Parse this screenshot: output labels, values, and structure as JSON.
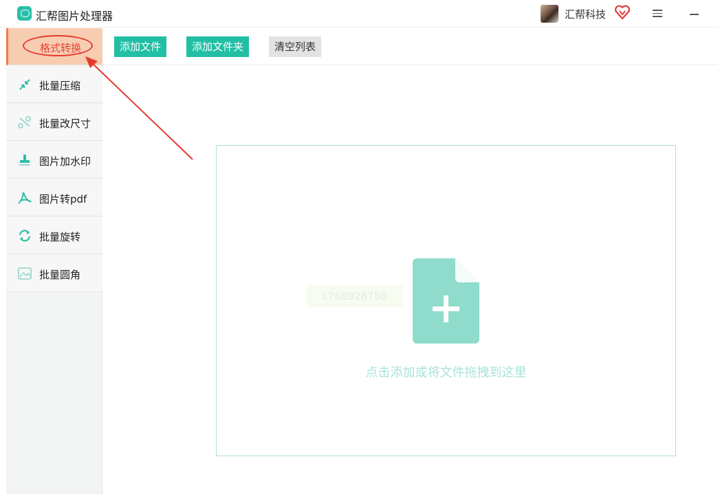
{
  "app": {
    "title": "汇帮图片处理器",
    "company": "汇帮科技",
    "icons": {
      "logo": "app-logo-icon",
      "vip": "vip-heart-icon",
      "menu": "hamburger-menu-icon",
      "minimize": "minimize-icon"
    }
  },
  "sidebar": {
    "items": [
      {
        "label": "格式转换",
        "icon": "format-convert-icon",
        "active": true
      },
      {
        "label": "批量压缩",
        "icon": "compress-icon"
      },
      {
        "label": "批量改尺寸",
        "icon": "resize-icon"
      },
      {
        "label": "图片加水印",
        "icon": "watermark-stamp-icon"
      },
      {
        "label": "图片转pdf",
        "icon": "pdf-icon"
      },
      {
        "label": "批量旋转",
        "icon": "rotate-icon"
      },
      {
        "label": "批量圆角",
        "icon": "rounded-corner-image-icon"
      }
    ]
  },
  "toolbar": {
    "add_file": "添加文件",
    "add_folder": "添加文件夹",
    "clear_list": "清空列表"
  },
  "dropzone": {
    "hint": "点击添加或将文件拖拽到这里",
    "icon": "file-add-icon",
    "watermark_text": "1768926786"
  },
  "colors": {
    "accent": "#22bfa5",
    "active_bg": "#f7cdb1",
    "active_text": "#e8433a",
    "annotation": "#e63a2e",
    "dropzone_border": "#a8e0d5"
  }
}
